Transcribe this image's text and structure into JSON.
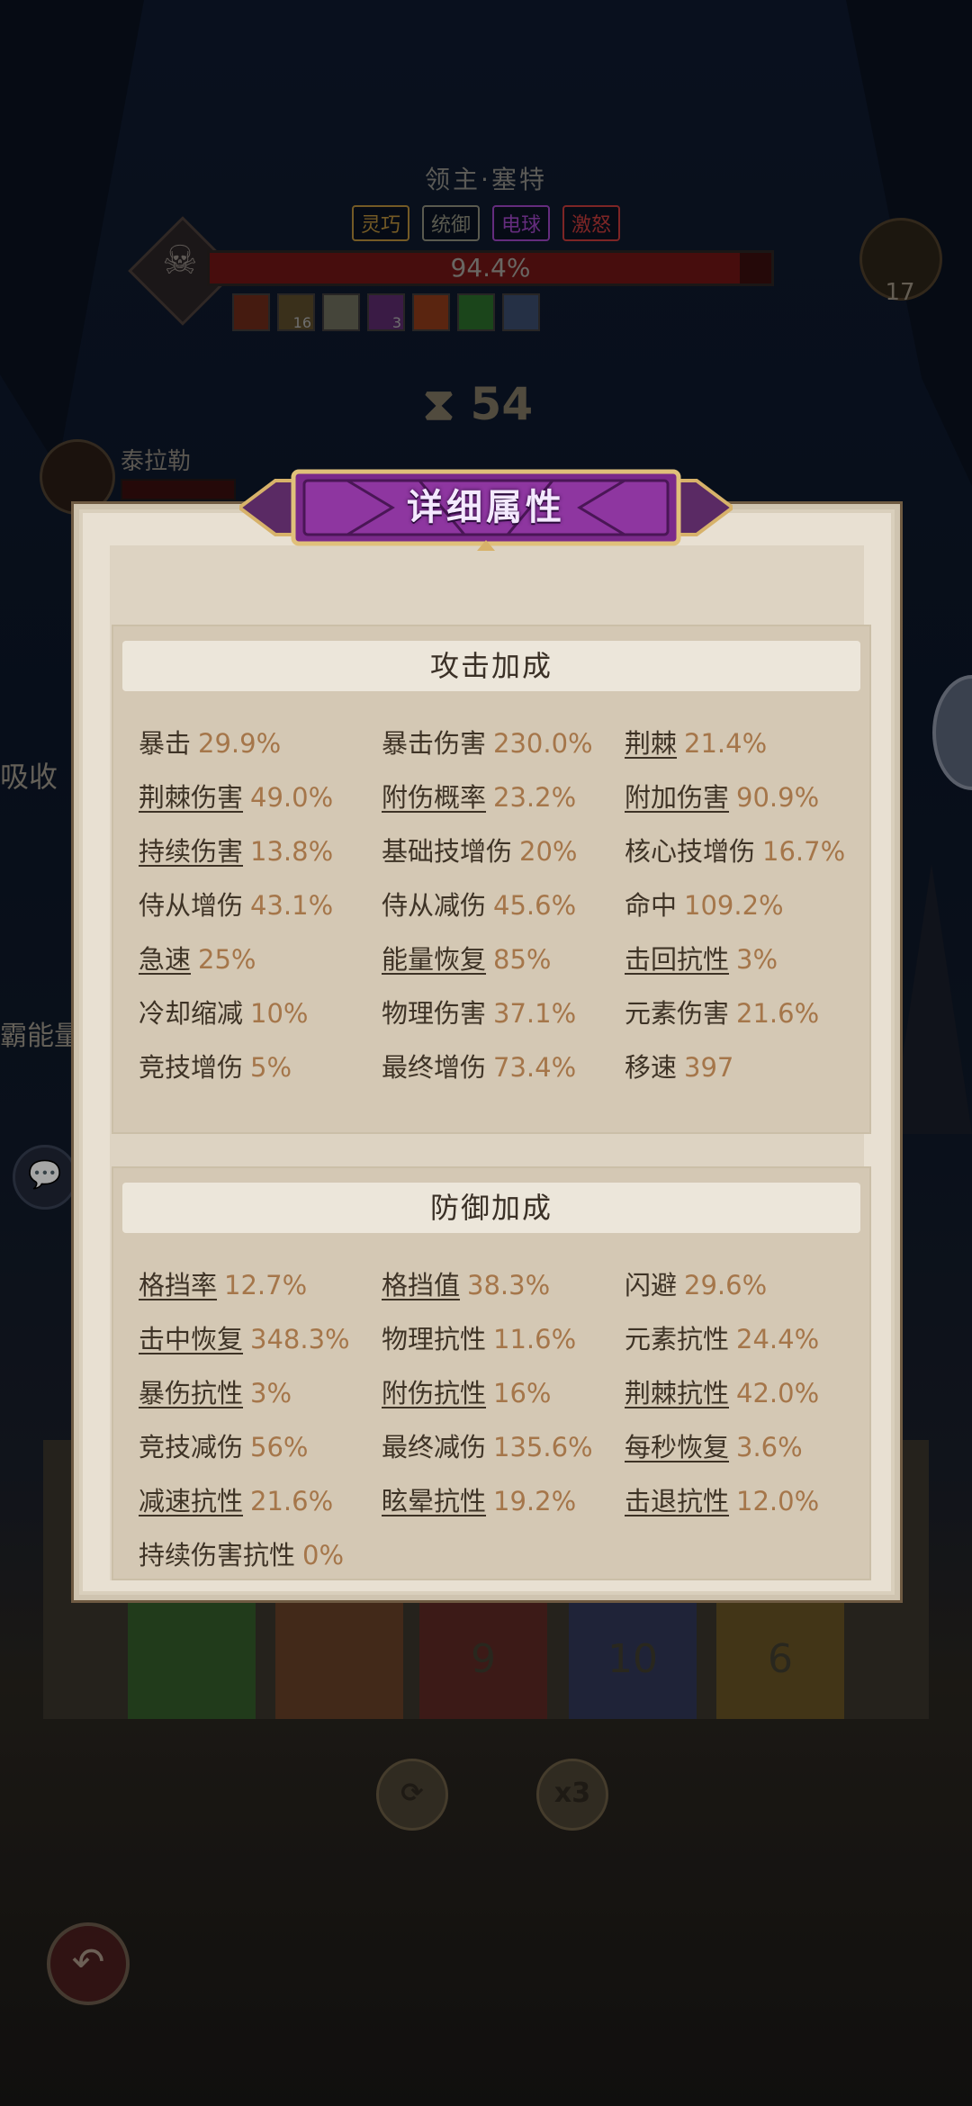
{
  "boss": {
    "name": "领主·塞特",
    "tags": [
      {
        "label": "灵巧",
        "color": "#b28a3a"
      },
      {
        "label": "统御",
        "color": "#8a8a7a"
      },
      {
        "label": "电球",
        "color": "#9a44c0"
      },
      {
        "label": "激怒",
        "color": "#c03a3a"
      }
    ],
    "hp_percent_text": "94.4%",
    "hp_fraction": 0.944,
    "debuffs": [
      {
        "icon": "fire-debuff-icon",
        "count": ""
      },
      {
        "icon": "stack-debuff-icon",
        "count": "16"
      },
      {
        "icon": "stone-debuff-icon",
        "count": ""
      },
      {
        "icon": "arcane-debuff-icon",
        "count": "3"
      },
      {
        "icon": "burn-debuff-icon",
        "count": ""
      },
      {
        "icon": "poison-debuff-icon",
        "count": ""
      },
      {
        "icon": "frost-debuff-icon",
        "count": ""
      }
    ]
  },
  "chest": {
    "count": "17",
    "icon": "treasure-chest-icon"
  },
  "timer": {
    "value": "54",
    "icon": "hourglass-icon"
  },
  "hero": {
    "name": "泰拉勒"
  },
  "side_texts": {
    "left_top": "吸收",
    "left_mid": "霸能量"
  },
  "cards": [
    {
      "label": "",
      "color": "#2e7a2a"
    },
    {
      "label": "",
      "color": "#8a4a24"
    },
    {
      "label": "9",
      "color": "#7a1e1e"
    },
    {
      "label": "10",
      "color": "#2a3a7a"
    },
    {
      "label": "6",
      "color": "#8a6a1e"
    }
  ],
  "bottom": {
    "refresh_icon": "refresh-icon",
    "speed_label": "x3"
  },
  "panel": {
    "title": "详细属性",
    "attack": {
      "header": "攻击加成",
      "stats": [
        {
          "label": "暴击",
          "value": "29.9%",
          "link": false
        },
        {
          "label": "暴击伤害",
          "value": "230.0%",
          "link": false
        },
        {
          "label": "荆棘",
          "value": "21.4%",
          "link": true
        },
        {
          "label": "荆棘伤害",
          "value": "49.0%",
          "link": true
        },
        {
          "label": "附伤概率",
          "value": "23.2%",
          "link": true
        },
        {
          "label": "附加伤害",
          "value": "90.9%",
          "link": true
        },
        {
          "label": "持续伤害",
          "value": "13.8%",
          "link": true
        },
        {
          "label": "基础技增伤",
          "value": "20%",
          "link": false
        },
        {
          "label": "核心技增伤",
          "value": "16.7%",
          "link": false
        },
        {
          "label": "侍从增伤",
          "value": "43.1%",
          "link": false
        },
        {
          "label": "侍从减伤",
          "value": "45.6%",
          "link": false
        },
        {
          "label": "命中",
          "value": "109.2%",
          "link": false
        },
        {
          "label": "急速",
          "value": "25%",
          "link": true
        },
        {
          "label": "能量恢复",
          "value": "85%",
          "link": true
        },
        {
          "label": "击回抗性",
          "value": "3%",
          "link": true
        },
        {
          "label": "冷却缩减",
          "value": "10%",
          "link": false
        },
        {
          "label": "物理伤害",
          "value": "37.1%",
          "link": false
        },
        {
          "label": "元素伤害",
          "value": "21.6%",
          "link": false
        },
        {
          "label": "竞技增伤",
          "value": "5%",
          "link": false
        },
        {
          "label": "最终增伤",
          "value": "73.4%",
          "link": false
        },
        {
          "label": "移速",
          "value": "397",
          "link": false
        }
      ]
    },
    "defense": {
      "header": "防御加成",
      "stats": [
        {
          "label": "格挡率",
          "value": "12.7%",
          "link": true
        },
        {
          "label": "格挡值",
          "value": "38.3%",
          "link": true
        },
        {
          "label": "闪避",
          "value": "29.6%",
          "link": false
        },
        {
          "label": "击中恢复",
          "value": "348.3%",
          "link": true
        },
        {
          "label": "物理抗性",
          "value": "11.6%",
          "link": false
        },
        {
          "label": "元素抗性",
          "value": "24.4%",
          "link": false
        },
        {
          "label": "暴伤抗性",
          "value": "3%",
          "link": true
        },
        {
          "label": "附伤抗性",
          "value": "16%",
          "link": true
        },
        {
          "label": "荆棘抗性",
          "value": "42.0%",
          "link": true
        },
        {
          "label": "竞技减伤",
          "value": "56%",
          "link": false
        },
        {
          "label": "最终减伤",
          "value": "135.6%",
          "link": false
        },
        {
          "label": "每秒恢复",
          "value": "3.6%",
          "link": true
        },
        {
          "label": "减速抗性",
          "value": "21.6%",
          "link": true
        },
        {
          "label": "眩晕抗性",
          "value": "19.2%",
          "link": true
        },
        {
          "label": "击退抗性",
          "value": "12.0%",
          "link": true
        },
        {
          "label": "持续伤害抗性",
          "value": "0%",
          "link": false
        }
      ]
    }
  }
}
